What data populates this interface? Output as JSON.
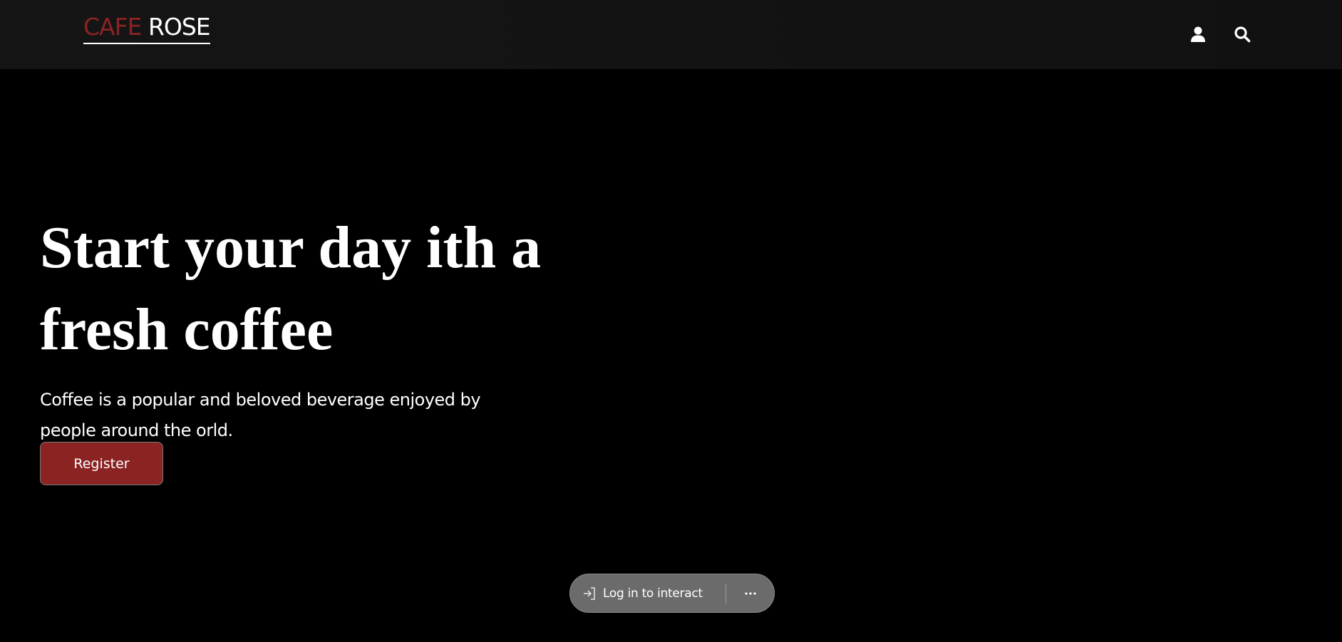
{
  "header": {
    "logo_part1": "CAFE",
    "logo_part2": " ROSE",
    "icons": [
      "user-icon",
      "search-icon"
    ]
  },
  "hero": {
    "title_line1": "Start your day ith a",
    "title_line2": "fresh coffee",
    "subtitle": "Coffee is a popular and beloved beverage enjoyed by people around the orld.",
    "register_label": "Register"
  },
  "overlay": {
    "login_label": "Log in to interact",
    "more_icon": "more-horizontal-icon"
  },
  "colors": {
    "brand_red": "#8b2323",
    "background": "#000000",
    "header_bg": "#151515",
    "pill_bg": "#6b6b6b"
  }
}
